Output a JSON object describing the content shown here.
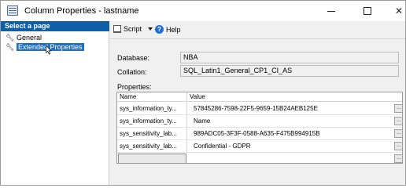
{
  "window": {
    "title": "Column Properties - lastname",
    "icon": "table-icon"
  },
  "left_pane": {
    "header": "Select a page",
    "items": [
      {
        "label": "General",
        "icon": "wrench-icon"
      },
      {
        "label": "Extended Properties",
        "icon": "wrench-icon",
        "selected": true
      }
    ]
  },
  "toolbar": {
    "script_label": "Script",
    "help_label": "Help"
  },
  "fields": {
    "database_label": "Database:",
    "database_value": "NBA",
    "collation_label": "Collation:",
    "collation_value": "SQL_Latin1_General_CP1_CI_AS"
  },
  "properties": {
    "label": "Properties:",
    "columns": [
      "Name",
      "Value"
    ],
    "rows": [
      {
        "name": "sys_information_ty...",
        "value": "57845286-7598-22F5-9659-15B24AEB125E"
      },
      {
        "name": "sys_information_ty...",
        "value": "Name"
      },
      {
        "name": "sys_sensitivity_lab...",
        "value": "989ADC05-3F3F-0588-A635-F475B994915B"
      },
      {
        "name": "sys_sensitivity_lab...",
        "value": "Confidential - GDPR"
      },
      {
        "name": "",
        "value": ""
      }
    ],
    "ellipsis": "..."
  },
  "colors": {
    "header_blue": "#0e5fa8",
    "selection_blue": "#1f6fc3",
    "help_blue": "#1e6fcf"
  }
}
